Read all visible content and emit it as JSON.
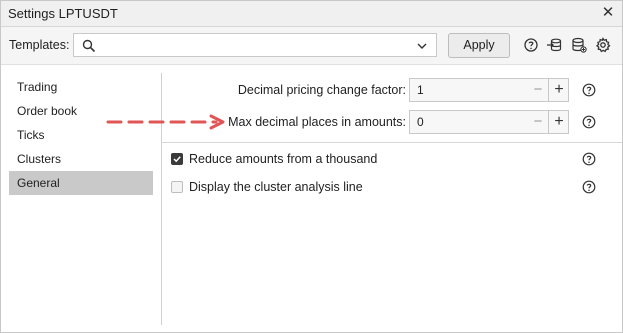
{
  "window": {
    "title": "Settings LPTUSDT",
    "close_glyph": "✕"
  },
  "toolbar": {
    "templates_label": "Templates:",
    "search_value": "",
    "apply_label": "Apply",
    "icons": [
      "help-icon",
      "import-icon",
      "database-icon",
      "gear-icon"
    ]
  },
  "sidebar": {
    "items": [
      {
        "label": "Trading",
        "active": false
      },
      {
        "label": "Order book",
        "active": false
      },
      {
        "label": "Ticks",
        "active": false
      },
      {
        "label": "Clusters",
        "active": false
      },
      {
        "label": "General",
        "active": true
      }
    ]
  },
  "general": {
    "decimal_factor": {
      "label": "Decimal pricing change factor:",
      "value": "1"
    },
    "max_decimal": {
      "label": "Max decimal places in amounts:",
      "value": "0"
    },
    "reduce_amounts": {
      "label": "Reduce amounts from a thousand",
      "checked": true
    },
    "cluster_line": {
      "label": "Display the cluster analysis line",
      "checked": false
    }
  },
  "annotation": {
    "type": "dashed-arrow",
    "color": "#e05555"
  },
  "colors": {
    "active_item": "#c9c9c9",
    "accent_arrow": "#e05555"
  }
}
